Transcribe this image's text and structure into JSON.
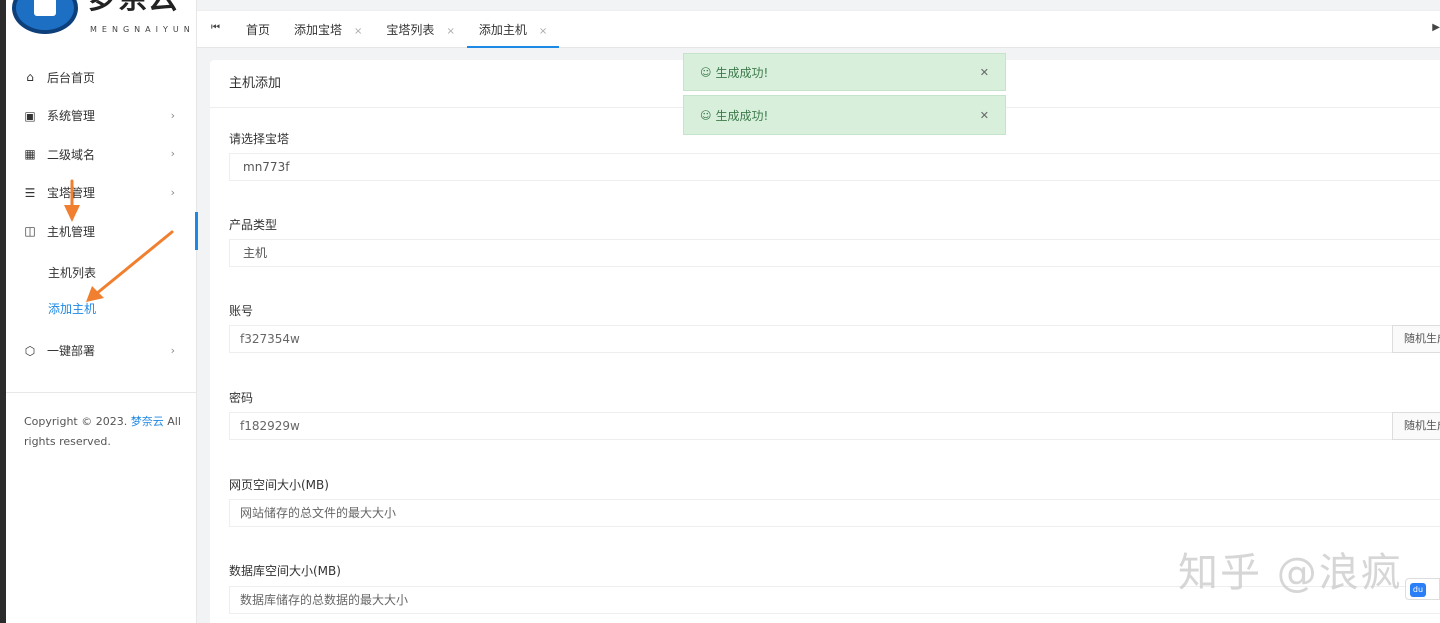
{
  "brand": {
    "name": "梦奈云",
    "sub": "MENGNAIYUN"
  },
  "sidebar": {
    "items": [
      {
        "label": "后台首页",
        "icon": "home-icon"
      },
      {
        "label": "系统管理",
        "icon": "terminal-icon"
      },
      {
        "label": "二级域名",
        "icon": "building-icon"
      },
      {
        "label": "宝塔管理",
        "icon": "server-icon"
      },
      {
        "label": "主机管理",
        "icon": "table-icon"
      },
      {
        "label": "一键部署",
        "icon": "hexagon-icon"
      }
    ],
    "sub_items": [
      {
        "label": "主机列表"
      },
      {
        "label": "添加主机"
      }
    ],
    "copyright_prefix": "Copyright © 2023.",
    "copyright_brand": "梦奈云",
    "copyright_suffix": "All rights reserved."
  },
  "tabs": [
    {
      "label": "首页"
    },
    {
      "label": "添加宝塔"
    },
    {
      "label": "宝塔列表"
    },
    {
      "label": "添加主机"
    }
  ],
  "form": {
    "title": "主机添加",
    "bt_label": "请选择宝塔",
    "bt_value": "mn773f",
    "type_label": "产品类型",
    "type_value": "主机",
    "account_label": "账号",
    "account_value": "f327354w",
    "account_button": "随机生成",
    "password_label": "密码",
    "password_value": "f182929w",
    "password_button": "随机生成",
    "web_size_label": "网页空间大小(MB)",
    "web_size_placeholder": "网站储存的总文件的最大大小",
    "db_size_label": "数据库空间大小(MB)",
    "db_size_placeholder": "数据库储存的总数据的最大大小"
  },
  "toasts": [
    {
      "text": "生成成功!"
    },
    {
      "text": "生成成功!"
    }
  ],
  "watermark": "知乎 @浪疯",
  "colors": {
    "accent": "#1e88e5",
    "toast_bg": "#d8efdc",
    "annotation_arrow": "#f08030"
  }
}
